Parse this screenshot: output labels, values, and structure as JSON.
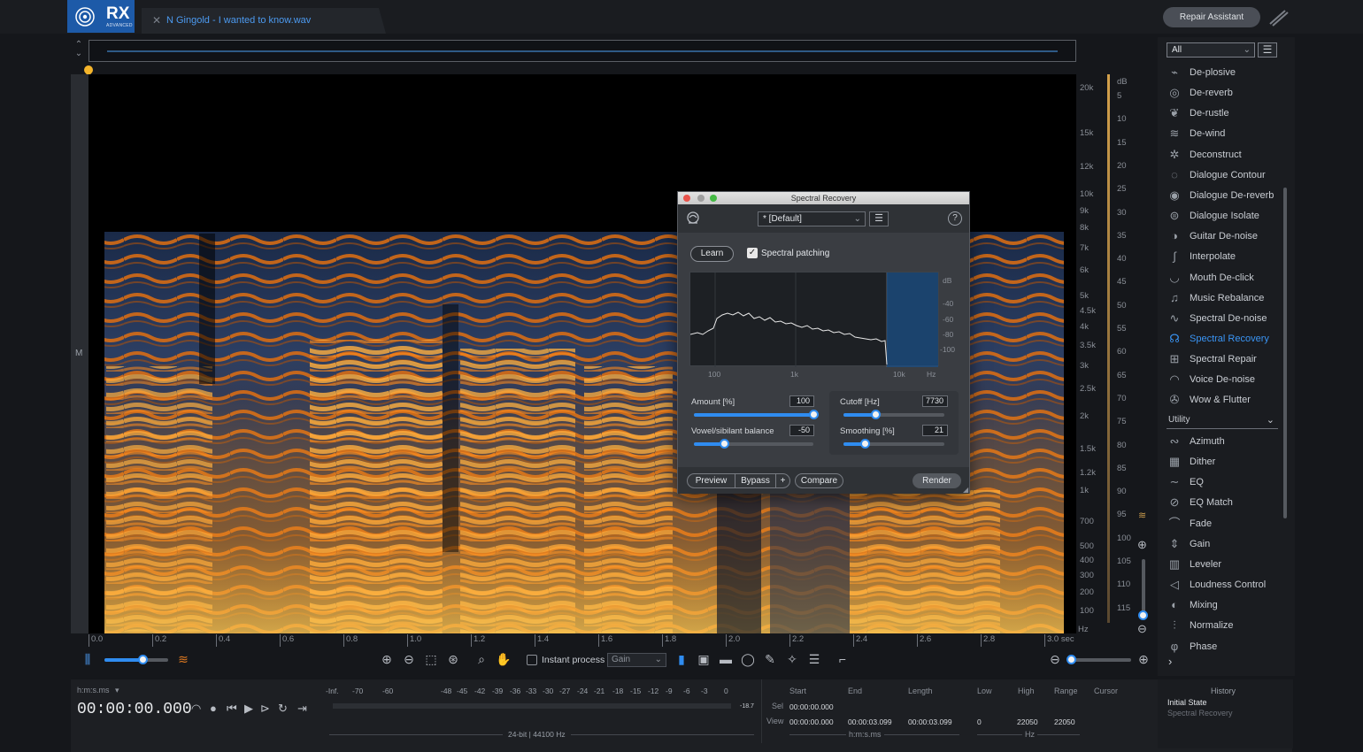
{
  "app": {
    "name": "RX",
    "edition": "ADVANCED",
    "file_tab": "N Gingold - I wanted to know.wav",
    "repair_assistant": "Repair Assistant"
  },
  "spectrogram": {
    "channel_label": "M",
    "freq_labels": [
      "20k",
      "15k",
      "12k",
      "10k",
      "9k",
      "8k",
      "7k",
      "6k",
      "5k",
      "4.5k",
      "4k",
      "3.5k",
      "3k",
      "2.5k",
      "2k",
      "1.5k",
      "1.2k",
      "1k",
      "700",
      "500",
      "400",
      "300",
      "200",
      "100",
      "Hz"
    ],
    "db_labels": [
      "dB",
      "5",
      "10",
      "15",
      "20",
      "25",
      "30",
      "35",
      "40",
      "45",
      "50",
      "55",
      "60",
      "65",
      "70",
      "75",
      "80",
      "85",
      "90",
      "95",
      "100",
      "105",
      "110",
      "115"
    ],
    "time_labels": [
      "0.0",
      "0.2",
      "0.4",
      "0.6",
      "0.8",
      "1.0",
      "1.2",
      "1.4",
      "1.6",
      "1.8",
      "2.0",
      "2.2",
      "2.4",
      "2.6",
      "2.8",
      "3.0 sec"
    ]
  },
  "toolbar": {
    "instant_process_label": "Instant process",
    "instant_process_checked": false,
    "mode_select": "Gain",
    "opacity_level": 0.6,
    "zoom_level": 0.05
  },
  "dialog": {
    "title": "Spectral Recovery",
    "preset": "* [Default]",
    "help": "?",
    "learn": "Learn",
    "spectral_patching_label": "Spectral patching",
    "spectral_patching_checked": true,
    "graph": {
      "db_labels": [
        "dB",
        "-40",
        "-60",
        "-80",
        "-100"
      ],
      "freq_labels": [
        "100",
        "1k",
        "10k",
        "Hz"
      ]
    },
    "amount_label": "Amount [%]",
    "amount_value": "100",
    "amount_level": 1.0,
    "balance_label": "Vowel/sibilant balance",
    "balance_value": "-50",
    "balance_level": 0.25,
    "cutoff_label": "Cutoff [Hz]",
    "cutoff_value": "7730",
    "cutoff_level": 0.32,
    "smoothing_label": "Smoothing [%]",
    "smoothing_value": "21",
    "smoothing_level": 0.21,
    "preview": "Preview",
    "bypass": "Bypass",
    "plus": "+",
    "compare": "Compare",
    "render": "Render"
  },
  "modules": {
    "filter": "All",
    "items": [
      {
        "label": "De-plosive",
        "icon": "de-plosive-icon",
        "glyph": "⌁"
      },
      {
        "label": "De-reverb",
        "icon": "de-reverb-icon",
        "glyph": "◎"
      },
      {
        "label": "De-rustle",
        "icon": "de-rustle-icon",
        "glyph": "❦"
      },
      {
        "label": "De-wind",
        "icon": "de-wind-icon",
        "glyph": "≋"
      },
      {
        "label": "Deconstruct",
        "icon": "deconstruct-icon",
        "glyph": "✲"
      },
      {
        "label": "Dialogue Contour",
        "icon": "dialogue-contour-icon",
        "glyph": "◌"
      },
      {
        "label": "Dialogue De-reverb",
        "icon": "dialogue-de-reverb-icon",
        "glyph": "◉"
      },
      {
        "label": "Dialogue Isolate",
        "icon": "dialogue-isolate-icon",
        "glyph": "⊜"
      },
      {
        "label": "Guitar De-noise",
        "icon": "guitar-de-noise-icon",
        "glyph": "◑"
      },
      {
        "label": "Interpolate",
        "icon": "interpolate-icon",
        "glyph": "∫"
      },
      {
        "label": "Mouth De-click",
        "icon": "mouth-de-click-icon",
        "glyph": "◡"
      },
      {
        "label": "Music Rebalance",
        "icon": "music-rebalance-icon",
        "glyph": "♫"
      },
      {
        "label": "Spectral De-noise",
        "icon": "spectral-de-noise-icon",
        "glyph": "∿"
      },
      {
        "label": "Spectral Recovery",
        "icon": "spectral-recovery-icon",
        "glyph": "☊"
      },
      {
        "label": "Spectral Repair",
        "icon": "spectral-repair-icon",
        "glyph": "⊞"
      },
      {
        "label": "Voice De-noise",
        "icon": "voice-de-noise-icon",
        "glyph": "◠"
      },
      {
        "label": "Wow & Flutter",
        "icon": "wow-flutter-icon",
        "glyph": "✇"
      }
    ],
    "active": "Spectral Recovery",
    "utility_header": "Utility",
    "utility": [
      {
        "label": "Azimuth",
        "icon": "azimuth-icon",
        "glyph": "∾"
      },
      {
        "label": "Dither",
        "icon": "dither-icon",
        "glyph": "▦"
      },
      {
        "label": "EQ",
        "icon": "eq-icon",
        "glyph": "∼"
      },
      {
        "label": "EQ Match",
        "icon": "eq-match-icon",
        "glyph": "⊘"
      },
      {
        "label": "Fade",
        "icon": "fade-icon",
        "glyph": "⌒"
      },
      {
        "label": "Gain",
        "icon": "gain-icon",
        "glyph": "⇕"
      },
      {
        "label": "Leveler",
        "icon": "leveler-icon",
        "glyph": "▥"
      },
      {
        "label": "Loudness Control",
        "icon": "loudness-control-icon",
        "glyph": "◁"
      },
      {
        "label": "Mixing",
        "icon": "mixing-icon",
        "glyph": "◐"
      },
      {
        "label": "Normalize",
        "icon": "normalize-icon",
        "glyph": "⫶"
      },
      {
        "label": "Phase",
        "icon": "phase-icon",
        "glyph": "φ"
      }
    ]
  },
  "transport": {
    "format_label": "h:m:s.ms",
    "timecode": "00:00:00.000"
  },
  "meter": {
    "scale": [
      "-Inf.",
      "-70",
      "-60",
      "-48",
      "-45",
      "-42",
      "-39",
      "-36",
      "-33",
      "-30",
      "-27",
      "-24",
      "-21",
      "-18",
      "-15",
      "-12",
      "-9",
      "-6",
      "-3",
      "0"
    ],
    "peak": "-18.7",
    "format": "24-bit | 44100 Hz"
  },
  "selection": {
    "start_label": "Start",
    "end_label": "End",
    "length_label": "Length",
    "sel_label": "Sel",
    "view_label": "View",
    "sel_start": "00:00:00.000",
    "view_start": "00:00:00.000",
    "view_end": "00:00:03.099",
    "view_length": "00:00:03.099",
    "units": "h:m:s.ms",
    "low_label": "Low",
    "high_label": "High",
    "range_label": "Range",
    "cursor_label": "Cursor",
    "low": "0",
    "high": "22050",
    "range": "22050",
    "freq_units": "Hz"
  },
  "history": {
    "title": "History",
    "initial_state": "Initial State",
    "last_item": "Spectral Recovery"
  }
}
